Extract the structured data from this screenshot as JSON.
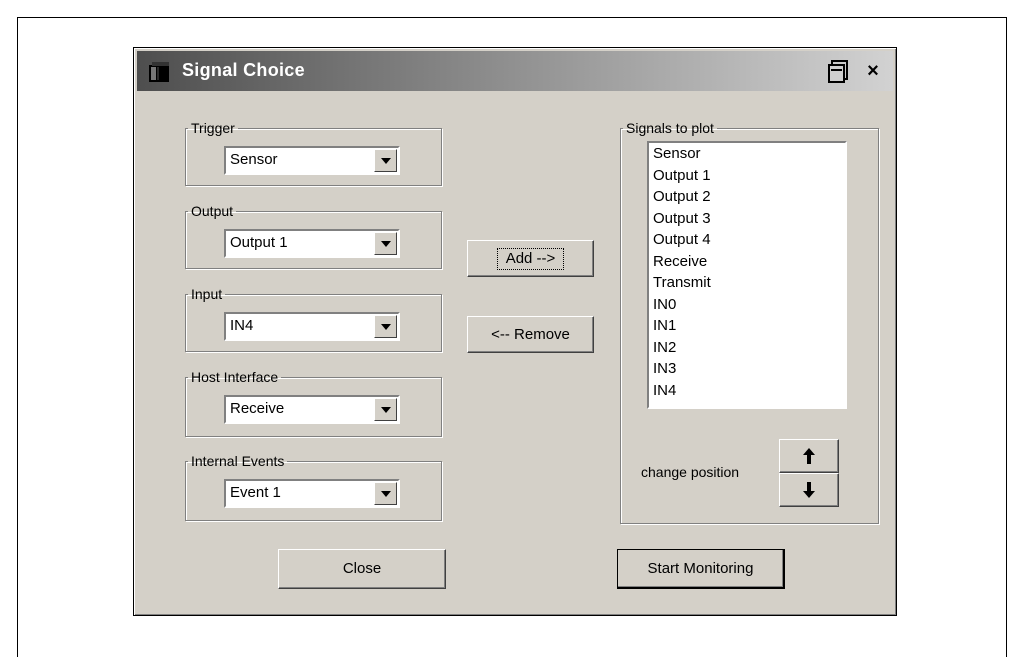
{
  "window": {
    "title": "Signal Choice",
    "restore_icon": "restore-icon",
    "close_glyph": "×"
  },
  "groups": {
    "trigger": {
      "legend": "Trigger",
      "value": "Sensor"
    },
    "output": {
      "legend": "Output",
      "value": "Output 1"
    },
    "input": {
      "legend": "Input",
      "value": "IN4"
    },
    "host_interface": {
      "legend": "Host Interface",
      "value": "Receive"
    },
    "internal_events": {
      "legend": "Internal Events",
      "value": "Event 1"
    }
  },
  "buttons": {
    "add": "Add -->",
    "remove": "<-- Remove",
    "close": "Close",
    "start_monitoring": "Start Monitoring",
    "move_up_icon": "up-arrow-icon",
    "move_down_icon": "down-arrow-icon"
  },
  "signals": {
    "legend": "Signals to plot",
    "items": [
      "Sensor",
      "Output 1",
      "Output 2",
      "Output 3",
      "Output 4",
      "Receive",
      "Transmit",
      "IN0",
      "IN1",
      "IN2",
      "IN3",
      "IN4"
    ],
    "change_position_label": "change position"
  }
}
